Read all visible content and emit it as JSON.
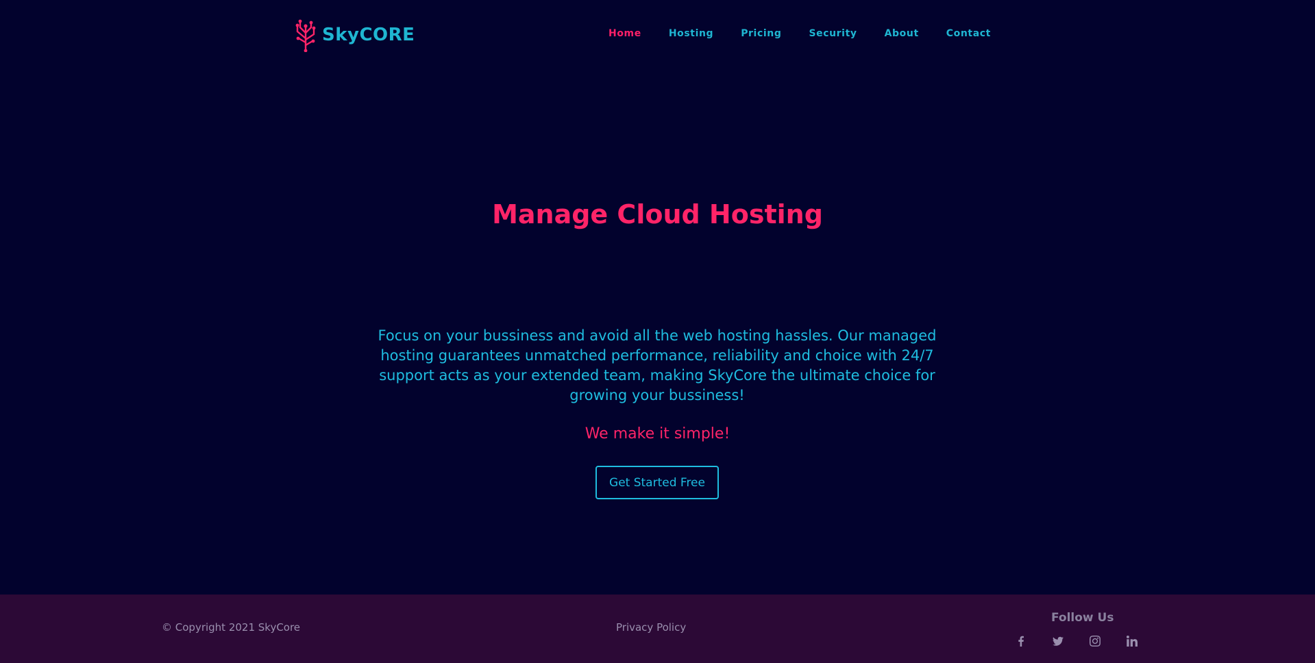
{
  "header": {
    "logo_text": "SkyCORE",
    "nav": [
      {
        "label": "Home",
        "active": true
      },
      {
        "label": "Hosting"
      },
      {
        "label": "Pricing"
      },
      {
        "label": "Security"
      },
      {
        "label": "About"
      },
      {
        "label": "Contact"
      }
    ]
  },
  "hero": {
    "title": "Manage Cloud Hosting",
    "description": "Focus on your bussiness and avoid all the web hosting hassles. Our managed hosting guarantees unmatched performance, reliability and choice with 24/7 support acts as your extended team, making SkyCore the ultimate choice for growing your bussiness!",
    "tagline": "We make it simple!",
    "cta_label": "Get Started Free"
  },
  "footer": {
    "copyright": "© Copyright 2021 SkyCore",
    "privacy": "Privacy Policy",
    "follow_title": "Follow Us",
    "socials": [
      "facebook-icon",
      "twitter-icon",
      "instagram-icon",
      "linkedin-icon"
    ]
  },
  "colors": {
    "background": "#02022d",
    "footer_background": "#2c0936",
    "accent_pink": "#ff2468",
    "accent_cyan": "#1fbde0",
    "muted_text": "#9a8fae"
  }
}
